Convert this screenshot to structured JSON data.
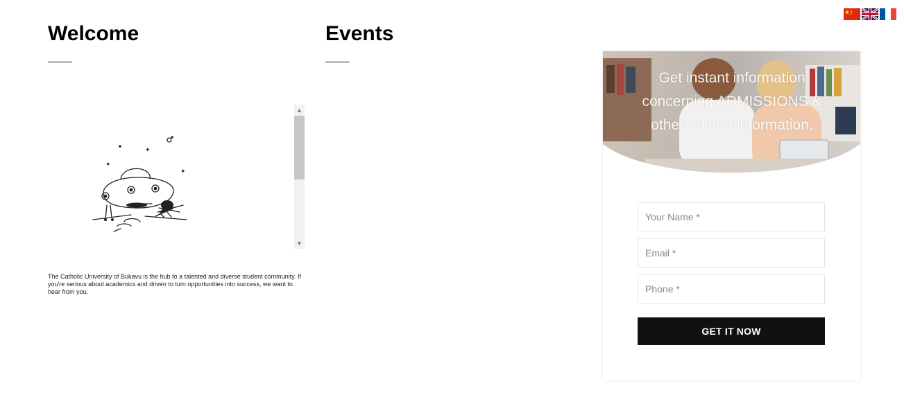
{
  "languages": [
    {
      "name": "chinese",
      "icon": "china-flag-icon"
    },
    {
      "name": "english",
      "icon": "uk-flag-icon"
    },
    {
      "name": "french",
      "icon": "france-flag-icon"
    }
  ],
  "welcome": {
    "title": "Welcome",
    "text": "The Catholic University of Bukavu is the hub to a talented and diverse student community. If you're serious about academics and driven to turn opportunities into success, we want to hear from you."
  },
  "events": {
    "title": "Events"
  },
  "form": {
    "headline": "Get instant information concerning ADMISSIONS & other related information.",
    "name_placeholder": "Your Name *",
    "email_placeholder": "Email *",
    "phone_placeholder": "Phone *",
    "submit_label": "GET IT NOW"
  },
  "colors": {
    "button": "#111111",
    "scrollbar_track": "#f1f1f1",
    "scrollbar_thumb": "#c6c6c6"
  }
}
